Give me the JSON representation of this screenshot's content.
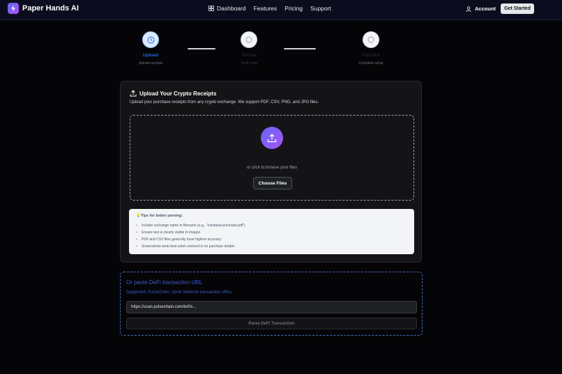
{
  "header": {
    "brand": "Paper Hands AI",
    "nav": [
      {
        "label": "Dashboard",
        "icon": "dashboard-grid-icon"
      },
      {
        "label": "Features"
      },
      {
        "label": "Pricing"
      },
      {
        "label": "Support"
      }
    ],
    "account_label": "Account",
    "cta_label": "Get Started"
  },
  "steps": [
    {
      "label": "Upload",
      "sub": "Upload receipts",
      "state": "active"
    },
    {
      "label": "Review",
      "sub": "Verify data",
      "state": "inactive"
    },
    {
      "label": "Payment",
      "sub": "Complete setup",
      "state": "inactive"
    }
  ],
  "upload_card": {
    "title": "Upload Your Crypto Receipts",
    "subtitle": "Upload your purchase receipts from any crypto exchange. We support PDF, CSV, PNG, and JPG files.",
    "browse_text": "or click to browse your files",
    "choose_label": "Choose Files",
    "tips_title": "Tips for better parsing:",
    "tips": [
      "Include exchange name in filename (e.g., \"coinbase-purchase.pdf\")",
      "Ensure text is clearly visible in images",
      "PDF and CSV files generally have highest accuracy",
      "Screenshots work best when zoomed in on purchase details"
    ]
  },
  "defi": {
    "title": "Or paste DeFi transaction URL",
    "subtitle": "Supported: PulseChain, Sonic Network transaction URLs",
    "placeholder": "https://scan.pulsechain.com/tx/0x...",
    "button_label": "Parse DeFi Transaction"
  },
  "colors": {
    "accent": "#2563eb",
    "brand_gradient_start": "#6366f1",
    "brand_gradient_end": "#a855f7"
  }
}
